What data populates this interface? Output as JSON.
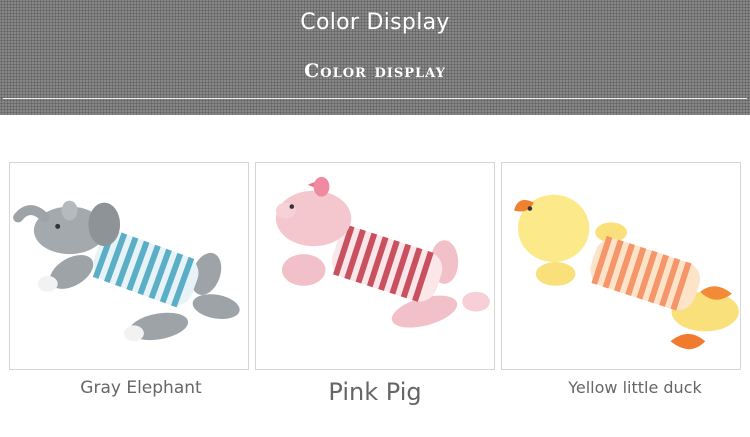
{
  "banner": {
    "title": "Color Display",
    "subtitle": "Color display"
  },
  "products": [
    {
      "name": "Gray Elephant",
      "icon": "gray-elephant-toy-image",
      "color": "#9aa0a6"
    },
    {
      "name": "Pink Pig",
      "icon": "pink-pig-toy-image",
      "color": "#f3c4cc"
    },
    {
      "name": "Yellow little duck",
      "icon": "yellow-duck-toy-image",
      "color": "#fbe47a"
    }
  ]
}
